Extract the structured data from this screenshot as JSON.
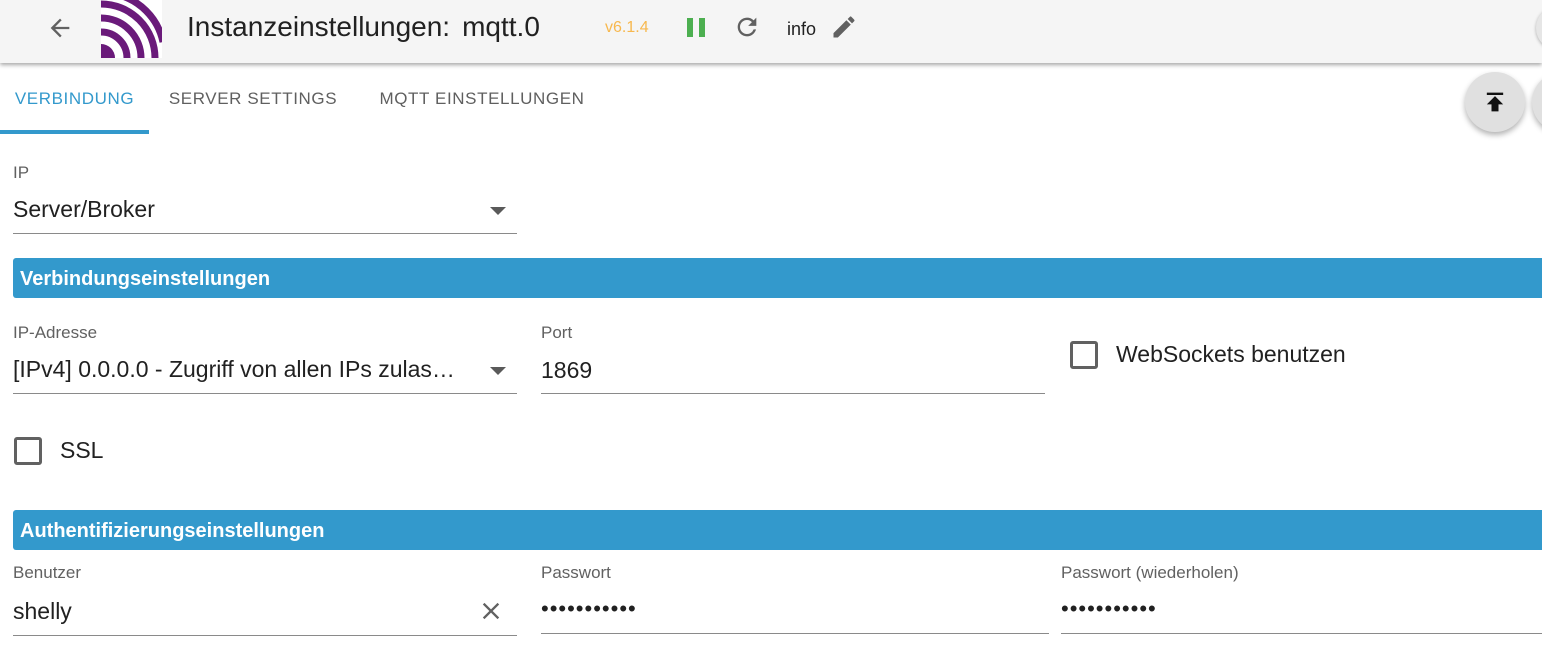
{
  "header": {
    "title": "Instanzeinstellungen:",
    "instance": "mqtt.0",
    "version": "v6.1.4",
    "log_level": "info",
    "colors": {
      "version": "#f7b84e",
      "pause": "#4caf50",
      "accent": "#3399cc"
    },
    "icons": [
      "arrow-back-icon",
      "mqtt-logo",
      "pause-icon",
      "refresh-icon",
      "pencil-icon"
    ]
  },
  "tabs": [
    {
      "label": "VERBINDUNG",
      "active": true
    },
    {
      "label": "SERVER SETTINGS",
      "active": false
    },
    {
      "label": "MQTT EINSTELLUNGEN",
      "active": false
    }
  ],
  "form": {
    "ip_type": {
      "label": "IP",
      "value": "Server/Broker"
    },
    "connection_section": "Verbindungseinstellungen",
    "ip_address": {
      "label": "IP-Adresse",
      "value": "[IPv4] 0.0.0.0 - Zugriff von allen IPs zulas…"
    },
    "port": {
      "label": "Port",
      "value": "1869"
    },
    "websockets": {
      "label": "WebSockets benutzen",
      "checked": false
    },
    "ssl": {
      "label": "SSL",
      "checked": false
    },
    "auth_section": "Authentifizierungseinstellungen",
    "user": {
      "label": "Benutzer",
      "value": "shelly"
    },
    "password": {
      "label": "Passwort",
      "value": "•••••••••••"
    },
    "password_repeat": {
      "label": "Passwort (wiederholen)",
      "value": "•••••••••••"
    }
  }
}
